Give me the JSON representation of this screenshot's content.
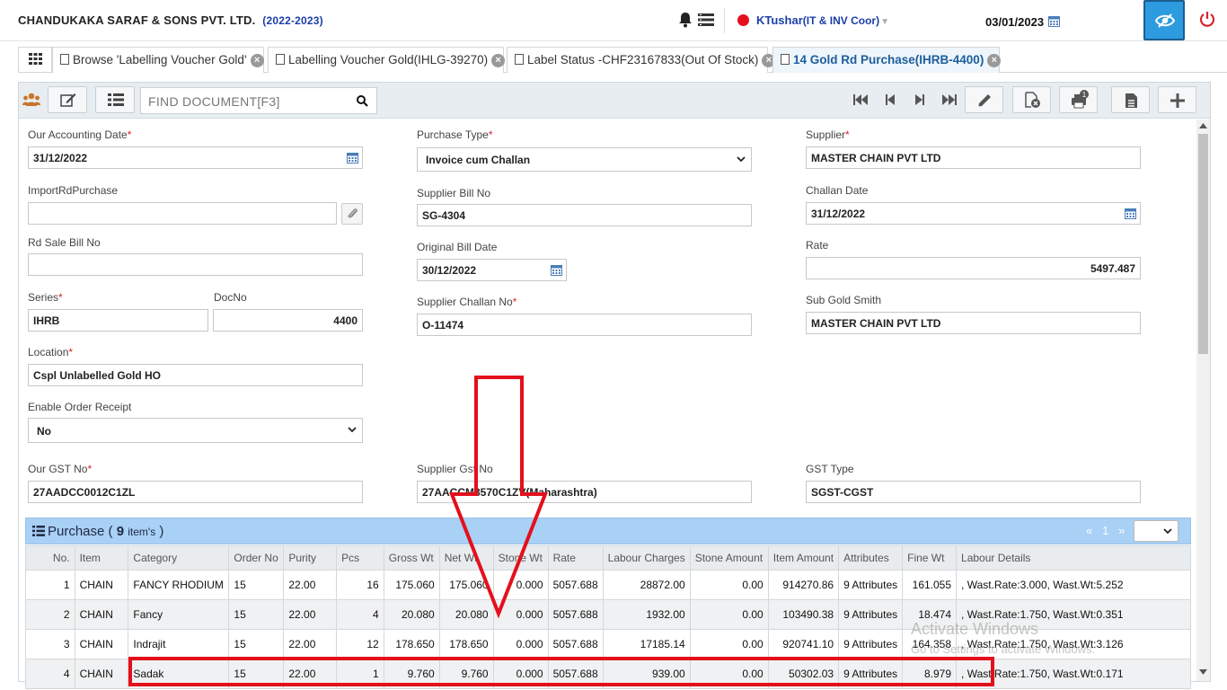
{
  "header": {
    "company": "CHANDUKAKA SARAF & SONS PVT. LTD.",
    "year": "(2022-2023)",
    "user_name": "KTushar",
    "user_role": "(IT & INV Coor)",
    "date": "03/01/2023"
  },
  "tabs": [
    {
      "label": "Browse 'Labelling Voucher Gold'"
    },
    {
      "label": "Labelling Voucher Gold(IHLG-39270)"
    },
    {
      "label": "Label Status -CHF23167833(Out Of Stock)"
    },
    {
      "label": "14 Gold Rd Purchase(IHRB-4400)",
      "active": true
    }
  ],
  "toolbar": {
    "find_placeholder": "FIND DOCUMENT[F3]"
  },
  "form": {
    "accounting_date_label": "Our Accounting Date",
    "accounting_date": "31/12/2022",
    "import_label": "ImportRdPurchase",
    "import_value": "",
    "rd_sale_label": "Rd Sale Bill No",
    "rd_sale_value": "",
    "series_label": "Series",
    "series": "IHRB",
    "docno_label": "DocNo",
    "docno": "4400",
    "location_label": "Location",
    "location": "Cspl Unlabelled Gold HO",
    "enable_order_label": "Enable Order Receipt",
    "enable_order": "No",
    "our_gst_label": "Our GST No",
    "our_gst": "27AADCC0012C1ZL",
    "purchase_type_label": "Purchase Type",
    "purchase_type": "Invoice cum Challan",
    "supplier_bill_label": "Supplier Bill No",
    "supplier_bill": "SG-4304",
    "original_bill_date_label": "Original Bill Date",
    "original_bill_date": "30/12/2022",
    "supplier_challan_label": "Supplier Challan No",
    "supplier_challan": "O-11474",
    "supplier_gst_label": "Supplier Gst No",
    "supplier_gst": "27AACCM8570C1ZV(Maharashtra)",
    "supplier_label": "Supplier",
    "supplier": "MASTER CHAIN PVT LTD",
    "challan_date_label": "Challan Date",
    "challan_date": "31/12/2022",
    "rate_label": "Rate",
    "rate": "5497.487",
    "sub_goldsmith_label": "Sub Gold Smith",
    "sub_goldsmith": "MASTER CHAIN PVT LTD",
    "gst_type_label": "GST Type",
    "gst_type": "SGST-CGST"
  },
  "purchase": {
    "title": "Purchase (",
    "count": "9",
    "items_word": "item's",
    "close": ")",
    "page": "1",
    "columns": [
      "No.",
      "Item",
      "Category",
      "Order No",
      "Purity",
      "Pcs",
      "Gross Wt",
      "Net Wt",
      "Stone Wt",
      "Rate",
      "Labour Charges",
      "Stone Amount",
      "Item Amount",
      "Attributes",
      "Fine Wt",
      "Labour Details"
    ],
    "rows": [
      [
        "1",
        "CHAIN",
        "FANCY RHODIUM",
        "15",
        "22.00",
        "16",
        "175.060",
        "175.060",
        "0.000",
        "5057.688",
        "28872.00",
        "0.00",
        "914270.86",
        "9 Attributes",
        "161.055",
        ", Wast.Rate:3.000, Wast.Wt:5.252"
      ],
      [
        "2",
        "CHAIN",
        "Fancy",
        "15",
        "22.00",
        "4",
        "20.080",
        "20.080",
        "0.000",
        "5057.688",
        "1932.00",
        "0.00",
        "103490.38",
        "9 Attributes",
        "18.474",
        ", Wast.Rate:1.750, Wast.Wt:0.351"
      ],
      [
        "3",
        "CHAIN",
        "Indrajit",
        "15",
        "22.00",
        "12",
        "178.650",
        "178.650",
        "0.000",
        "5057.688",
        "17185.14",
        "0.00",
        "920741.10",
        "9 Attributes",
        "164.358",
        ", Wast.Rate:1.750, Wast.Wt:3.126"
      ],
      [
        "4",
        "CHAIN",
        "Sadak",
        "15",
        "22.00",
        "1",
        "9.760",
        "9.760",
        "0.000",
        "5057.688",
        "939.00",
        "0.00",
        "50302.03",
        "9 Attributes",
        "8.979",
        ", Wast.Rate:1.750, Wast.Wt:0.171"
      ]
    ]
  },
  "watermark": {
    "line1": "Activate Windows",
    "line2": "Go to Settings to activate Windows."
  },
  "colors": {
    "accent": "#1d5e9b",
    "annotation": "#e3101c",
    "grid_header": "#a9d0f5"
  }
}
